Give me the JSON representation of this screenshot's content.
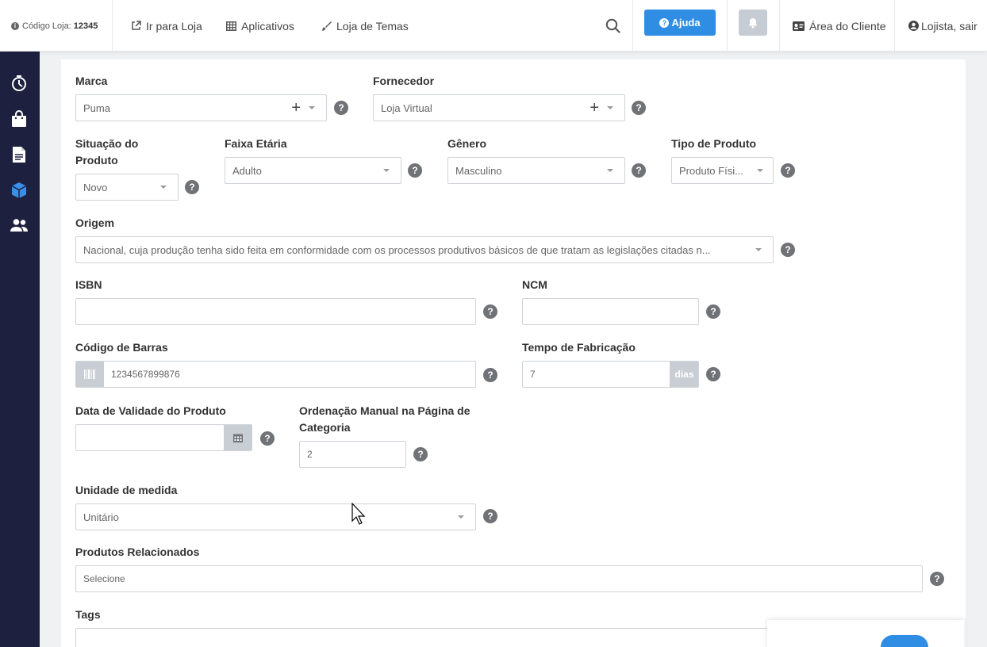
{
  "topbar": {
    "store_code_label": "Código Loja:",
    "store_code": "12345",
    "links": [
      "Ir para Loja",
      "Aplicativos",
      "Loja de Temas"
    ],
    "help_label": "Ajuda",
    "client_area": "Área do Cliente",
    "logout": "Lojista, sair"
  },
  "form": {
    "marca": {
      "label": "Marca",
      "value": "Puma"
    },
    "fornecedor": {
      "label": "Fornecedor",
      "value": "Loja Virtual"
    },
    "situacao": {
      "label": "Situação do Produto",
      "value": "Novo"
    },
    "faixa": {
      "label": "Faixa Etária",
      "value": "Adulto"
    },
    "genero": {
      "label": "Gênero",
      "value": "Masculino"
    },
    "tipo": {
      "label": "Tipo de Produto",
      "value": "Produto Físi..."
    },
    "origem": {
      "label": "Origem",
      "value": "Nacional, cuja produção tenha sido feita em conformidade com os processos produtivos básicos de que tratam as legislações citadas n..."
    },
    "isbn": {
      "label": "ISBN",
      "value": ""
    },
    "ncm": {
      "label": "NCM",
      "value": ""
    },
    "codigo_barras": {
      "label": "Código de Barras",
      "value": "1234567899876"
    },
    "tempo_fabricacao": {
      "label": "Tempo de Fabricação",
      "value": "7",
      "unit": "dias"
    },
    "data_validade": {
      "label": "Data de Validade do Produto",
      "value": ""
    },
    "ordenacao": {
      "label": "Ordenação Manual na Página de Categoria",
      "value": "2"
    },
    "unidade": {
      "label": "Unidade de medida",
      "value": "Unitário"
    },
    "relacionados": {
      "label": "Produtos Relacionados",
      "placeholder": "Selecione"
    },
    "tags": {
      "label": "Tags"
    }
  },
  "help_glyph": "?",
  "colors": {
    "primary": "#2f8de4",
    "sidebar": "#1e2040",
    "help_icon": "#6f7277"
  }
}
